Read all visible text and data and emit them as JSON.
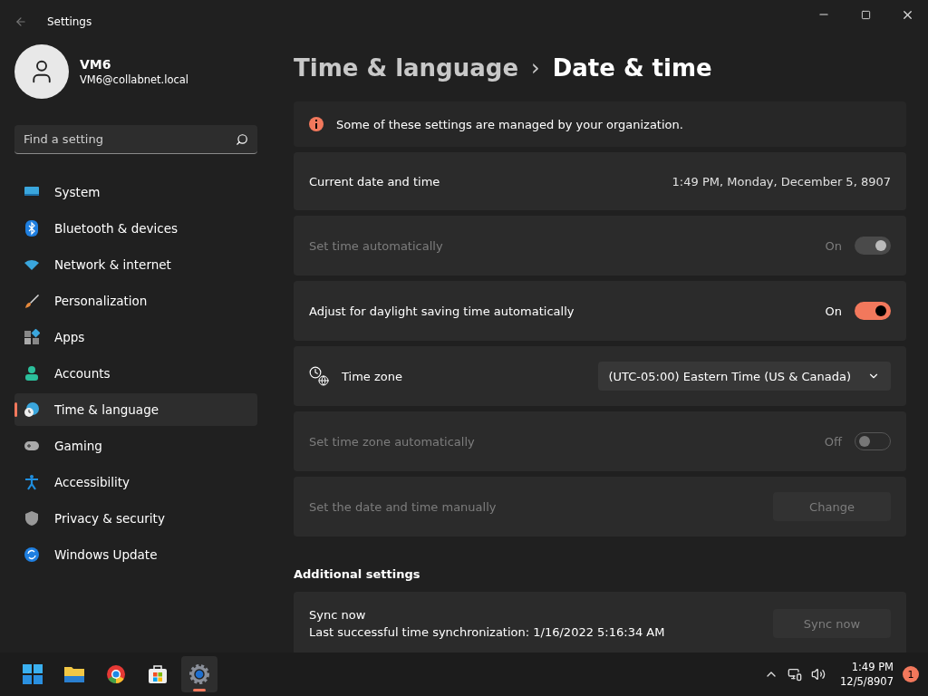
{
  "window": {
    "title": "Settings"
  },
  "account": {
    "name": "VM6",
    "email": "VM6@collabnet.local"
  },
  "search": {
    "placeholder": "Find a setting"
  },
  "sidebar": {
    "items": [
      {
        "label": "System",
        "selected": false
      },
      {
        "label": "Bluetooth & devices",
        "selected": false
      },
      {
        "label": "Network & internet",
        "selected": false
      },
      {
        "label": "Personalization",
        "selected": false
      },
      {
        "label": "Apps",
        "selected": false
      },
      {
        "label": "Accounts",
        "selected": false
      },
      {
        "label": "Time & language",
        "selected": true
      },
      {
        "label": "Gaming",
        "selected": false
      },
      {
        "label": "Accessibility",
        "selected": false
      },
      {
        "label": "Privacy & security",
        "selected": false
      },
      {
        "label": "Windows Update",
        "selected": false
      }
    ]
  },
  "breadcrumb": {
    "parent": "Time & language",
    "separator": "›",
    "current": "Date & time"
  },
  "notice": "Some of these settings are managed by your organization.",
  "rows": [
    {
      "kind": "value",
      "label": "Current date and time",
      "value": "1:49 PM, Monday, December 5, 8907",
      "disabled": false
    },
    {
      "kind": "toggle",
      "label": "Set time automatically",
      "state_text": "On",
      "on": true,
      "disabled": true
    },
    {
      "kind": "toggle",
      "label": "Adjust for daylight saving time automatically",
      "state_text": "On",
      "on": true,
      "disabled": false
    },
    {
      "kind": "dropdown",
      "label": "Time zone",
      "value": "(UTC-05:00) Eastern Time (US & Canada)",
      "disabled": false
    },
    {
      "kind": "toggle",
      "label": "Set time zone automatically",
      "state_text": "Off",
      "on": false,
      "disabled": true
    },
    {
      "kind": "button",
      "label": "Set the date and time manually",
      "button": "Change",
      "disabled": true
    }
  ],
  "additional": {
    "heading": "Additional settings",
    "sync": {
      "title": "Sync now",
      "detail": "Last successful time synchronization: 1/16/2022 5:16:34 AM",
      "button": "Sync now",
      "disabled": true
    }
  },
  "taskbar": {
    "time": "1:49 PM",
    "date": "12/5/8907",
    "notifications": "1"
  }
}
